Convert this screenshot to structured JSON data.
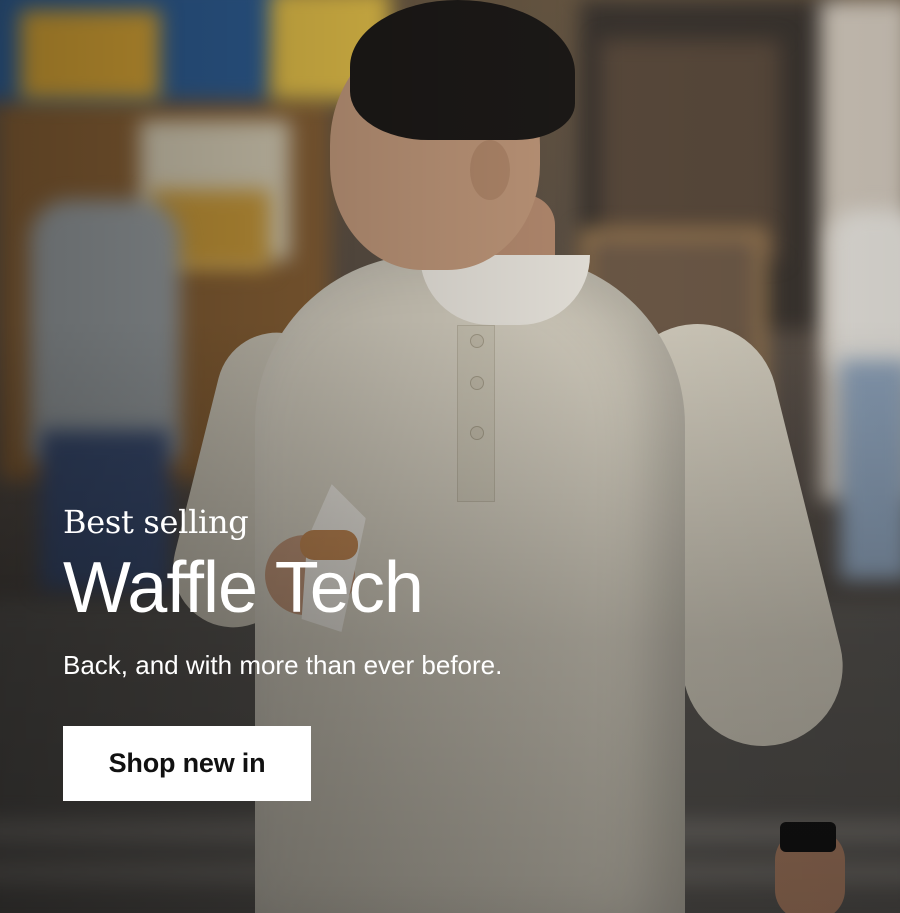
{
  "hero": {
    "eyebrow": "Best selling",
    "headline": "Waffle Tech",
    "subline": "Back, and with more than ever before.",
    "cta_label": "Shop new in"
  },
  "colors": {
    "text": "#ffffff",
    "cta_background": "#ffffff",
    "cta_text": "#111111",
    "shirt": "#d8d2c3"
  }
}
